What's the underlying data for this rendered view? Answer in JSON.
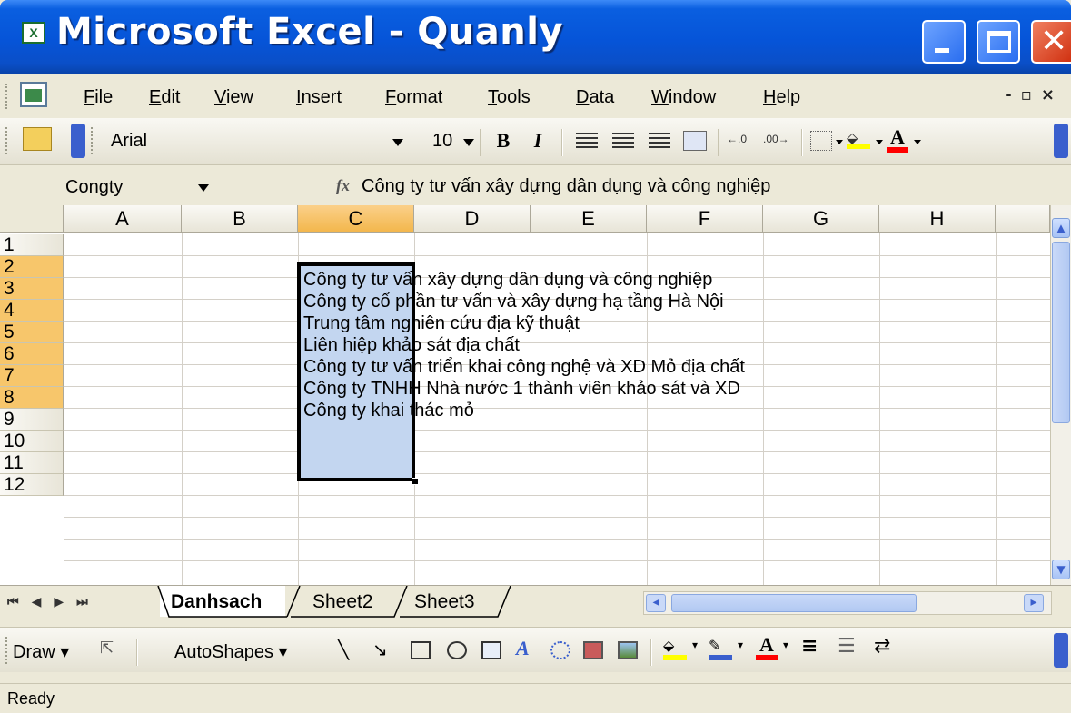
{
  "window": {
    "title": "Microsoft Excel - Quanly",
    "app_icon": "excel-icon",
    "controls": [
      "minimize-icon",
      "maximize-icon",
      "close-icon"
    ]
  },
  "menu": {
    "items": [
      "File",
      "Edit",
      "View",
      "Insert",
      "Format",
      "Tools",
      "Data",
      "Window",
      "Help"
    ]
  },
  "formatting": {
    "font_name": "Arial",
    "font_size": "10",
    "bold": "B",
    "italic": "I",
    "fill_color": "#ffff00",
    "font_color": "#ff0000"
  },
  "formula_bar": {
    "name_box": "Congty",
    "fx": "fx",
    "content": "Công ty tư vấn xây dựng dân dụng và công nghiệp"
  },
  "sheet": {
    "columns": [
      "A",
      "B",
      "C",
      "D",
      "E",
      "F",
      "G",
      "H"
    ],
    "rows": [
      "1",
      "2",
      "3",
      "4",
      "5",
      "6",
      "7",
      "8",
      "9",
      "10",
      "11",
      "12"
    ],
    "selected_column": "C",
    "selected_rows": [
      "2",
      "3",
      "4",
      "5",
      "6",
      "7",
      "8"
    ],
    "cells_C": [
      "Công ty tư vấn xây dựng dân dụng và công nghiệp",
      "Công ty cổ phần tư vấn và xây dựng hạ tầng Hà Nội",
      "Trung tâm nghiên cứu địa kỹ thuật",
      "Liên hiệp khảo sát địa chất",
      "Công ty tư vấn triển khai công nghệ và XD Mỏ địa chất",
      "Công ty TNHH Nhà nước 1 thành viên khảo sát và XD",
      "Công ty khai thác mỏ"
    ]
  },
  "tabs": {
    "sheets": [
      "Danhsach",
      "Sheet2",
      "Sheet3"
    ],
    "active": "Danhsach"
  },
  "drawing": {
    "draw_label": "Draw",
    "autoshapes_label": "AutoShapes"
  },
  "status": {
    "text": "Ready"
  }
}
